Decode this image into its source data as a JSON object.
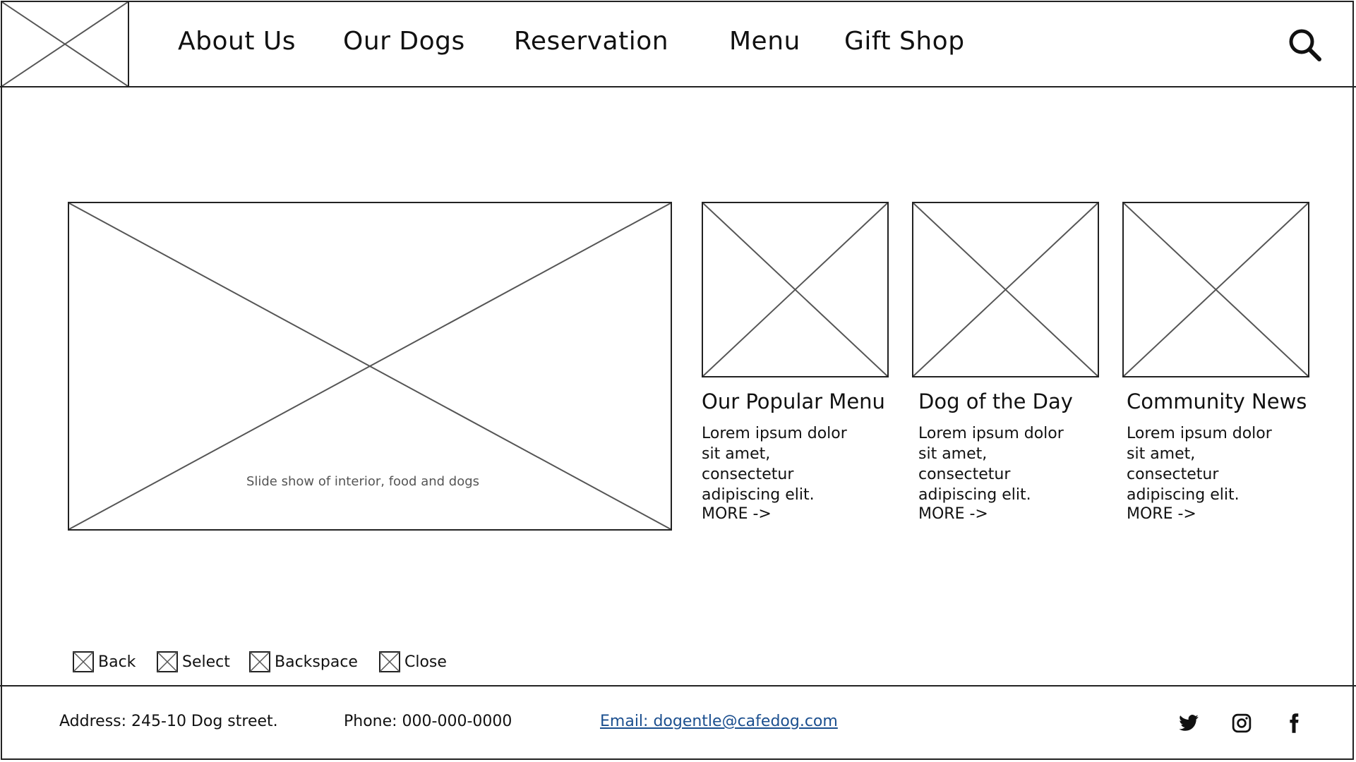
{
  "header": {
    "nav": [
      {
        "label": "About Us"
      },
      {
        "label": "Our Dogs"
      },
      {
        "label": "Reservation"
      },
      {
        "label": "Menu"
      },
      {
        "label": "Gift Shop"
      }
    ],
    "search_icon": "search-icon",
    "logo_icon": "image-placeholder-icon"
  },
  "hero": {
    "caption": "Slide show of interior, food and dogs"
  },
  "cards": [
    {
      "title": "Our Popular Menu",
      "text": "Lorem ipsum dolor sit amet, consectetur adipiscing elit.",
      "more": "MORE ->"
    },
    {
      "title": "Dog of the Day",
      "text": "Lorem ipsum dolor sit amet, consectetur adipiscing elit.",
      "more": "MORE ->"
    },
    {
      "title": "Community News",
      "text": "Lorem ipsum dolor sit amet, consectetur adipiscing elit.",
      "more": "MORE ->"
    }
  ],
  "keys": [
    {
      "label": "Back"
    },
    {
      "label": "Select"
    },
    {
      "label": "Backspace"
    },
    {
      "label": "Close"
    }
  ],
  "footer": {
    "address": "Address: 245-10 Dog street.",
    "phone": "Phone: 000-000-0000",
    "email": "Email: dogentle@cafedog.com",
    "link_color": "#1b4f8f",
    "social_icons": [
      "twitter-icon",
      "instagram-icon",
      "facebook-icon"
    ]
  }
}
